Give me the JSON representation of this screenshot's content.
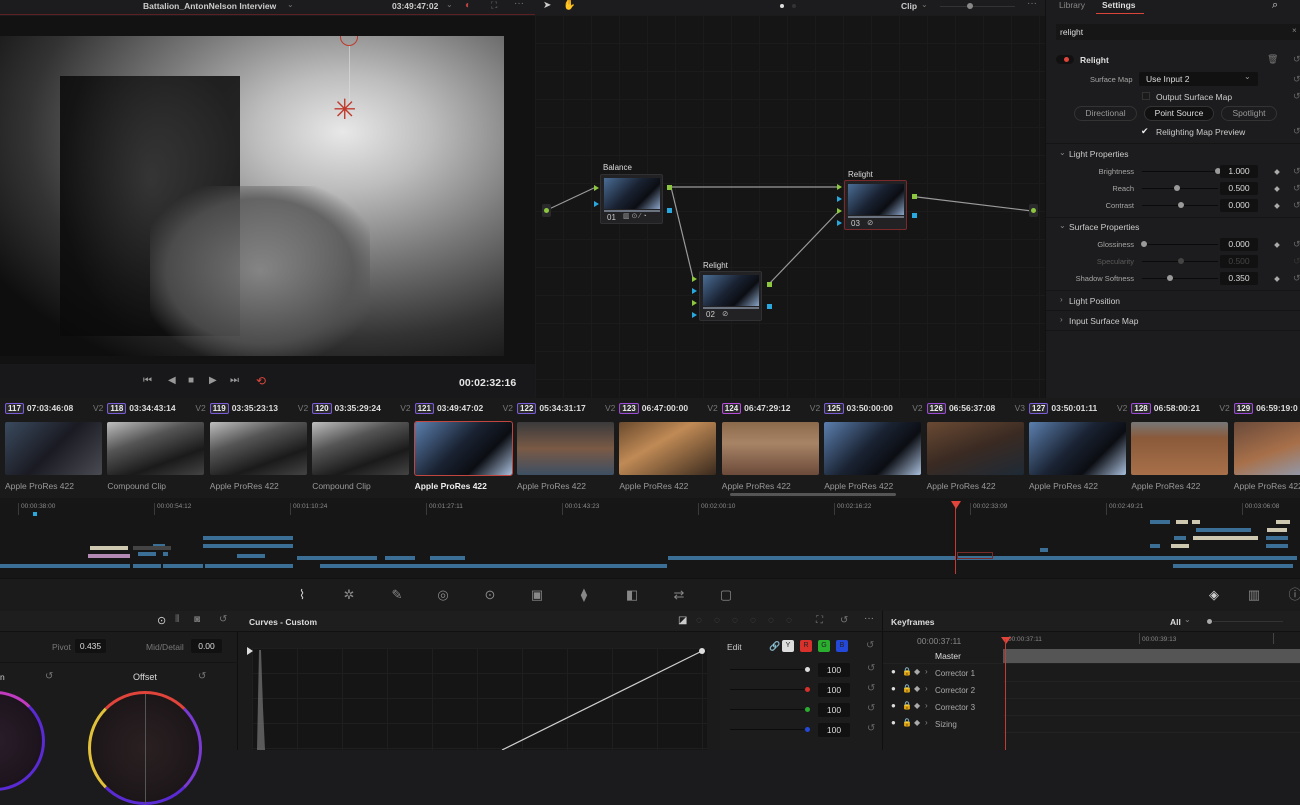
{
  "viewer": {
    "clip_title": "Battalion_AntonNelson Interview",
    "timecode_top": "03:49:47:02",
    "timecode": "00:02:32:16",
    "transport": [
      "skip-start",
      "step-back",
      "stop",
      "play",
      "skip-end",
      "loop"
    ]
  },
  "node_editor": {
    "mode": "Clip",
    "nodes": [
      {
        "label": "Balance",
        "number": "01"
      },
      {
        "label": "Relight",
        "number": "02"
      },
      {
        "label": "Relight",
        "number": "03"
      }
    ]
  },
  "settings": {
    "tabs": [
      "Library",
      "Settings"
    ],
    "active_tab": "Settings",
    "search_value": "relight",
    "effect_name": "Relight",
    "surface_map_label": "Surface Map",
    "surface_map_value": "Use Input 2",
    "output_surface_map": "Output Surface Map",
    "light_types": [
      "Directional",
      "Point Source",
      "Spotlight"
    ],
    "active_light_type": "Point Source",
    "relighting_preview": "Relighting Map Preview",
    "light_properties": {
      "title": "Light Properties",
      "params": [
        {
          "name": "Brightness",
          "value": "1.000",
          "level": 1.0
        },
        {
          "name": "Reach",
          "value": "0.500",
          "level": 0.45
        },
        {
          "name": "Contrast",
          "value": "0.000",
          "level": 0.5
        }
      ]
    },
    "surface_properties": {
      "title": "Surface Properties",
      "params": [
        {
          "name": "Glossiness",
          "value": "0.000",
          "level": 0.0
        },
        {
          "name": "Specularity",
          "value": "0.500",
          "level": 0.5,
          "disabled": true
        },
        {
          "name": "Shadow Softness",
          "value": "0.350",
          "level": 0.35
        }
      ]
    },
    "collapsed_sections": [
      "Light Position",
      "Input Surface Map"
    ]
  },
  "clips": [
    {
      "index": "117",
      "tc": "07:03:46:08",
      "track": "V2",
      "name": "Apple ProRes 422"
    },
    {
      "index": "118",
      "tc": "03:34:43:14",
      "track": "V2",
      "name": "Compound Clip"
    },
    {
      "index": "119",
      "tc": "03:35:23:13",
      "track": "V2",
      "name": "Apple ProRes 422"
    },
    {
      "index": "120",
      "tc": "03:35:29:24",
      "track": "V2",
      "name": "Compound Clip"
    },
    {
      "index": "121",
      "tc": "03:49:47:02",
      "track": "V2",
      "name": "Apple ProRes 422",
      "selected": true
    },
    {
      "index": "122",
      "tc": "05:34:31:17",
      "track": "V2",
      "name": "Apple ProRes 422"
    },
    {
      "index": "123",
      "tc": "06:47:00:00",
      "track": "V2",
      "name": "Apple ProRes 422"
    },
    {
      "index": "124",
      "tc": "06:47:29:12",
      "track": "V2",
      "name": "Apple ProRes 422"
    },
    {
      "index": "125",
      "tc": "03:50:00:00",
      "track": "V2",
      "name": "Apple ProRes 422"
    },
    {
      "index": "126",
      "tc": "06:56:37:08",
      "track": "V3",
      "name": "Apple ProRes 422"
    },
    {
      "index": "127",
      "tc": "03:50:01:11",
      "track": "V2",
      "name": "Apple ProRes 422"
    },
    {
      "index": "128",
      "tc": "06:58:00:21",
      "track": "V2",
      "name": "Apple ProRes 422"
    },
    {
      "index": "129",
      "tc": "06:59:19:0",
      "track": "",
      "name": "Apple ProRes 422"
    }
  ],
  "timeline": {
    "ticks": [
      "00:00:38:00",
      "00:00:54:12",
      "00:01:10:24",
      "00:01:27:11",
      "00:01:43:23",
      "00:02:00:10",
      "00:02:16:22",
      "00:02:33:09",
      "00:02:49:21",
      "00:03:06:08"
    ]
  },
  "curves": {
    "title": "Curves - Custom",
    "edit_label": "Edit",
    "channels": [
      "Y",
      "R",
      "G",
      "B"
    ],
    "intensities": [
      "100",
      "100",
      "100",
      "100"
    ]
  },
  "wheels": {
    "pivot_label": "Pivot",
    "pivot_value": "0.435",
    "mid_detail_label": "Mid/Detail",
    "mid_detail_value": "0.00",
    "offset_label": "Offset"
  },
  "keyframes": {
    "title": "Keyframes",
    "filter": "All",
    "current_tc": "00:00:37:11",
    "ruler": [
      "00:00:37:11",
      "00:00:39:13"
    ],
    "master": "Master",
    "tracks": [
      "Corrector 1",
      "Corrector 2",
      "Corrector 3",
      "Sizing"
    ]
  },
  "colors": {
    "accent_red": "#e0443a",
    "node_green": "#8dc63f",
    "node_blue": "#29a8e0",
    "clip_blue": "#3b6f95"
  }
}
